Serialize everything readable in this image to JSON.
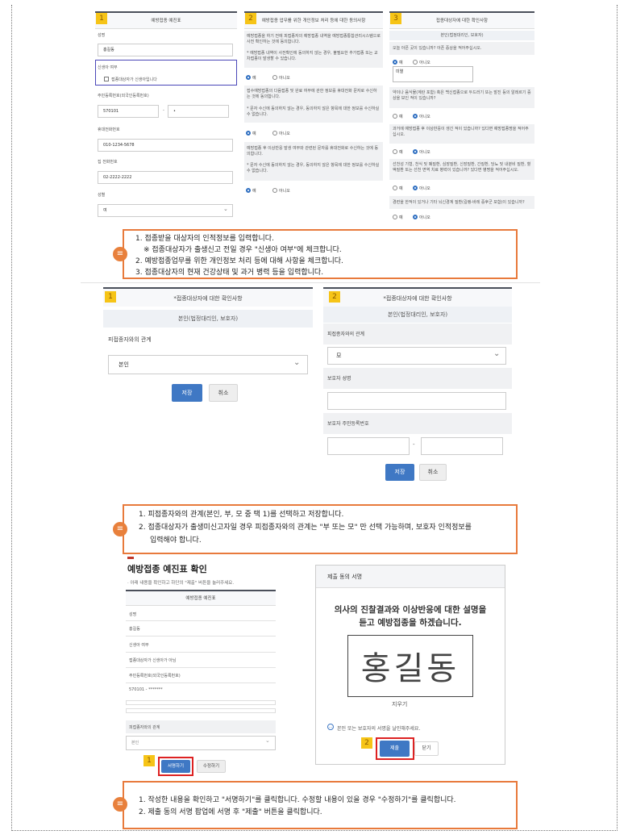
{
  "top": {
    "panel1": {
      "step": "1",
      "title": "예방접종 예진표",
      "name_label": "성명",
      "name_value": "홍길동",
      "newborn_label": "신생아 여부",
      "newborn_check": "접종대상자가 신생아입니다",
      "rrn_label": "주민등록번호(외국인등록번호)",
      "rrn_front": "570101",
      "rrn_dash": "-",
      "rrn_back": "•",
      "mobile_label": "휴대전화번호",
      "mobile_value": "010-1234-5678",
      "home_label": "집 전화번호",
      "home_value": "02-2222-2222",
      "gender_label": "성별",
      "gender_value": "여"
    },
    "panel2": {
      "step": "2",
      "title": "예방접종 업무를 위한 개인정보 처리 등에 대한 동의사항",
      "para1": "예방접종을 하기 전에 피접종자의 예방접종 내역을 예방접종통합관리시스템으로 사전 확인하는 것에 동의합니다.",
      "para1_note": "* 예방접종 내역이 사전확인에 동의하지 않는 경우, 불필요한 추가접종 또는 교차접종이 발생할 수 있습니다.",
      "para2": "접수예방접종의 다음접종 및 완료 여부에 관한 정보를 휴대전화 문자로 수신하는 것에 동의합니다.",
      "para2_note": "* 문자 수신에 동의하지 않는 경우, 동의하지 않은 항목에 대한 정보를 수신하실 수 없습니다.",
      "para3": "예방접종 후 이상반응 발생 여부와 관련된 문자를 휴대전화로 수신하는 것에 동의합니다.",
      "para3_note": "* 문자 수신에 동의하지 않는 경우, 동의하지 않은 항목에 대한 정보를 수신하실 수 없습니다.",
      "yes": "예",
      "no": "아니오"
    },
    "panel3": {
      "step": "3",
      "title": "접종대상자에 대한 확인사항",
      "sub": "본인(법정대리인, 보호자)",
      "q1": "오늘 아픈 곳이 있습니까? 아픈 증상을 적어주십시오.",
      "q1_answer": "미열",
      "q2": "약이나 음식물(계란 포함) 혹은 백신접종으로 두드러기 또는 발진 등의 알레르기 증상을 보인 적이 있습니까?",
      "q3": "과거에 예방접종 후 이상반응이 생긴 적이 있습니까? 있다면 예방접종명을 적어주십시오.",
      "q4": "선천성 기형, 천식 및 폐질환, 심장질환, 신장질환, 간질환, 당뇨 및 내분비 질환, 혈액질환 또는 선천 면역 치료 병력이 있습니까? 있다면 병명을 적어주십시오.",
      "q5": "경련을 한적이 있거나 기타 뇌신경계 질환(길랭-바레 증후군 포함)이 있습니까?",
      "yes": "예",
      "no": "아니오"
    },
    "notes": [
      "1. 접종받을 대상자의 인적정보를 입력합니다.",
      "※ 접종대상자가 출생신고 전일 경우 \"신생아 여부\"에 체크합니다.",
      "2. 예방접종업무를 위한 개인정보 처리 등에 대해 사항을 체크합니다.",
      "3. 접종대상자의 현재 건강상태 및 과거 병력 등을 입력합니다."
    ]
  },
  "middle": {
    "left": {
      "step": "1",
      "title": "*접종대상자에 대한 확인사항",
      "sub": "본인(법정대리인, 보호자)",
      "relation_label": "피접종자와의 관계",
      "relation_value": "본인",
      "save": "저장",
      "cancel": "취소"
    },
    "right": {
      "step": "2",
      "title": "*접종대상자에 대한 확인사항",
      "sub": "본인(법정대리인, 보호자)",
      "relation_label": "피접종자와의 관계",
      "relation_value": "모",
      "guardian_name_label": "보호자 성명",
      "guardian_rrn_label": "보호자 주민등록번호",
      "rrn_dash": "-",
      "save": "저장",
      "cancel": "취소"
    },
    "notes": [
      "1.   피접종자와의 관계(본인, 부, 모 중 택 1)를 선택하고 저장합니다.",
      "2.   접종대상자가 출생미신고자일 경우 피접종자와의 관계는 \"부 또는 모\" 만 선택 가능하며, 보호자 인적정보를",
      "입력해야 합니다."
    ]
  },
  "bottom": {
    "left": {
      "title": "예방접종 예진표 확인",
      "desc": "· 아래 내용을 확인하고 하단의 \"제출\" 버튼을 눌러주세요.",
      "table_title": "예방접종 예진표",
      "rows": [
        "성명",
        "홍길동",
        "신생아 여부",
        "접종대상자가 신생아가 아님",
        "주민등록번호(외국인등록번호)",
        "570101 - *******"
      ],
      "relation_label": "피접종자와의 관계",
      "relation_value": "본인",
      "step": "1",
      "sign_button": "서명하기",
      "edit_button": "수정하기"
    },
    "right": {
      "header": "제출 동의 서명",
      "statement_1": "의사의 진찰결과와 이상반응에 대한 설명을",
      "statement_2": "듣고 예방접종을 하겠습니다.",
      "signature": "홍길동",
      "clear": "지우기",
      "info": "본인 또는 보호자의 서명을 날인해주세요.",
      "step": "2",
      "submit": "제출",
      "close": "닫기"
    },
    "notes": [
      "1.   작성한 내용을 확인하고 \"서명하기\"를 클릭합니다. 수정할 내용이 있을 경우 \"수정하기\"를 클릭합니다.",
      "2.   제출 동의 서명 팝업에 서명 후 \"제출\" 버튼을 클릭합니다."
    ]
  },
  "colors": {
    "accent": "#3f78c4",
    "note_border": "#e87a3c",
    "badge": "#f6c417",
    "highlight": "#dd2222"
  },
  "icons": {
    "note": "document-icon",
    "info": "chat-icon",
    "dropdown": "chevron-down-icon"
  }
}
